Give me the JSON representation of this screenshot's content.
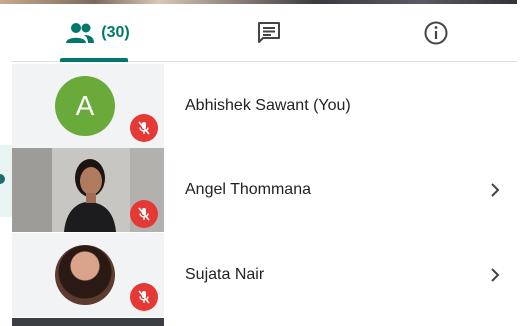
{
  "tabs": {
    "people": {
      "icon": "people-icon",
      "count_label": "(30)",
      "selected": true
    },
    "chat": {
      "icon": "chat-icon"
    },
    "info": {
      "icon": "info-icon"
    }
  },
  "participants": [
    {
      "name": "Abhishek Sawant (You)",
      "avatar": "letter",
      "avatar_letter": "A",
      "avatar_color": "#6aaa3a",
      "muted": true,
      "has_chevron": false
    },
    {
      "name": "Angel Thommana",
      "avatar": "video",
      "muted": true,
      "has_chevron": true
    },
    {
      "name": "Sujata Nair",
      "avatar": "photo",
      "muted": true,
      "has_chevron": true
    }
  ],
  "colors": {
    "accent": "#00796b",
    "mute_badge": "#e53935"
  }
}
